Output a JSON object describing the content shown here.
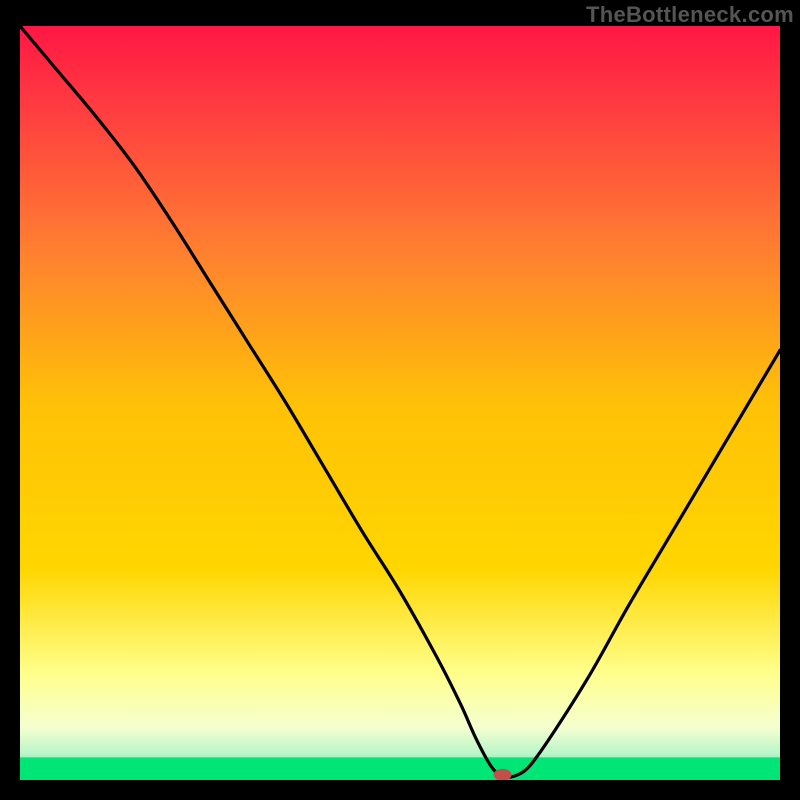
{
  "watermark": "TheBottleneck.com",
  "chart_data": {
    "type": "line",
    "title": "",
    "xlabel": "",
    "ylabel": "",
    "xlim": [
      0,
      100
    ],
    "ylim": [
      0,
      100
    ],
    "grid": false,
    "legend": false,
    "green_band": {
      "from_y": 0,
      "to_y": 3
    },
    "gradient_colors": {
      "top": "#ff1744",
      "mid": "#ffd600",
      "bottom_pale": "#ffffaa",
      "bottom_green": "#00e676"
    },
    "curve_color": "#000000",
    "marker": {
      "x": 63.5,
      "y": 0.7,
      "color": "#c2504a"
    },
    "series": [
      {
        "name": "bottleneck-curve",
        "x": [
          0,
          5,
          10,
          15,
          20,
          25,
          30,
          35,
          40,
          45,
          50,
          55,
          58,
          60,
          62,
          63.5,
          65,
          67,
          70,
          75,
          80,
          85,
          90,
          95,
          100
        ],
        "y": [
          100,
          94,
          88,
          81.5,
          74,
          66,
          58,
          50,
          41.5,
          33,
          25,
          16,
          10,
          5.5,
          1.8,
          0.5,
          0.5,
          1.8,
          6,
          14,
          23,
          31.5,
          40,
          48.5,
          57
        ]
      }
    ]
  }
}
